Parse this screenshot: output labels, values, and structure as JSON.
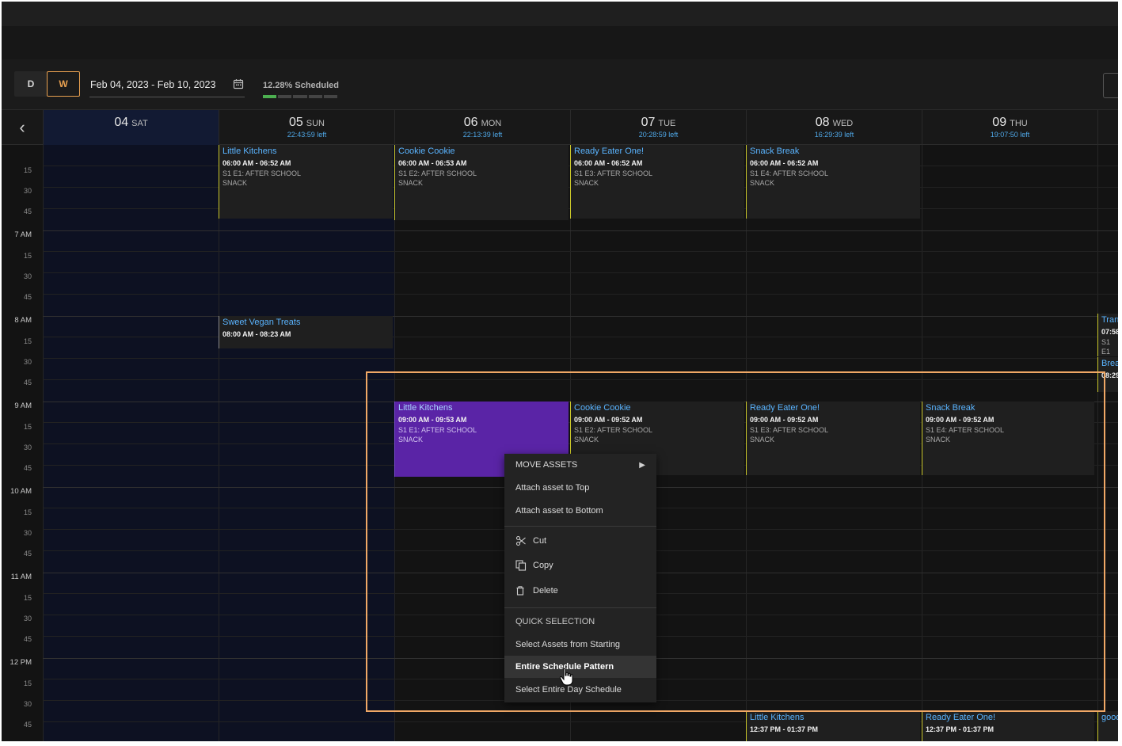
{
  "toolbar": {
    "day_label": "D",
    "week_label": "W",
    "date_range": "Feb 04, 2023 - Feb 10, 2023",
    "scheduled_text": "12.28% Scheduled",
    "scheduled_fraction": 0.1228
  },
  "days": [
    {
      "num": "04",
      "dow": "SAT",
      "left": ""
    },
    {
      "num": "05",
      "dow": "SUN",
      "left": "22:43:59 left"
    },
    {
      "num": "06",
      "dow": "MON",
      "left": "22:13:39 left"
    },
    {
      "num": "07",
      "dow": "TUE",
      "left": "20:28:59 left"
    },
    {
      "num": "08",
      "dow": "WED",
      "left": "16:29:39 left"
    },
    {
      "num": "09",
      "dow": "THU",
      "left": "19:07:50 left"
    }
  ],
  "time_labels": {
    "q15": "15",
    "q30": "30",
    "q45": "45",
    "h7": "7 AM",
    "h8": "8 AM",
    "h9": "9 AM",
    "h10": "10 AM",
    "h11": "11 AM",
    "h12": "12 PM"
  },
  "events": {
    "e1": {
      "title": "Little Kitchens",
      "time": "06:00 AM - 06:52 AM",
      "desc1": "S1 E1: AFTER SCHOOL",
      "desc2": "SNACK"
    },
    "e2": {
      "title": "Cookie Cookie",
      "time": "06:00 AM - 06:53 AM",
      "desc1": "S1 E2: AFTER SCHOOL",
      "desc2": "SNACK"
    },
    "e3": {
      "title": "Ready Eater One!",
      "time": "06:00 AM - 06:52 AM",
      "desc1": "S1 E3: AFTER SCHOOL",
      "desc2": "SNACK"
    },
    "e4": {
      "title": "Snack Break",
      "time": "06:00 AM - 06:52 AM",
      "desc1": "S1 E4: AFTER SCHOOL",
      "desc2": "SNACK"
    },
    "e5": {
      "title": "Sweet Vegan Treats",
      "time": "08:00 AM - 08:23 AM"
    },
    "e6": {
      "title": "Little Kitchens",
      "time": "09:00 AM - 09:53 AM",
      "desc1": "S1 E1: AFTER SCHOOL",
      "desc2": "SNACK"
    },
    "e7": {
      "title": "Cookie Cookie",
      "time": "09:00 AM - 09:52 AM",
      "desc1": "S1 E2: AFTER SCHOOL",
      "desc2": "SNACK"
    },
    "e8": {
      "title": "Ready Eater One!",
      "time": "09:00 AM - 09:52 AM",
      "desc1": "S1 E3: AFTER SCHOOL",
      "desc2": "SNACK"
    },
    "e9": {
      "title": "Snack Break",
      "time": "09:00 AM - 09:52 AM",
      "desc1": "S1 E4: AFTER SCHOOL",
      "desc2": "SNACK"
    },
    "e10": {
      "title": "Little Kitchens",
      "time": "12:37 PM - 01:37 PM"
    },
    "e11": {
      "title": "Ready Eater One!",
      "time": "12:37 PM - 01:37 PM"
    },
    "e12": {
      "title": "Tran",
      "time": "07:58",
      "desc1": "S1 E1"
    },
    "e13": {
      "title": "Brea",
      "time": "08:29"
    },
    "e14": {
      "title": "good"
    }
  },
  "context_menu": {
    "move_assets": "MOVE ASSETS",
    "attach_top": "Attach asset to Top",
    "attach_bottom": "Attach asset to Bottom",
    "cut": "Cut",
    "copy": "Copy",
    "delete": "Delete",
    "quick_selection": "QUICK SELECTION",
    "select_from_starting": "Select Assets from Starting",
    "entire_pattern": "Entire Schedule Pattern",
    "entire_day": "Select Entire Day Schedule"
  },
  "icons": [
    "calendar-icon",
    "chevron-left-icon",
    "scissors-icon",
    "copy-icon",
    "trash-icon",
    "submenu-arrow-icon",
    "hand-cursor-icon"
  ]
}
